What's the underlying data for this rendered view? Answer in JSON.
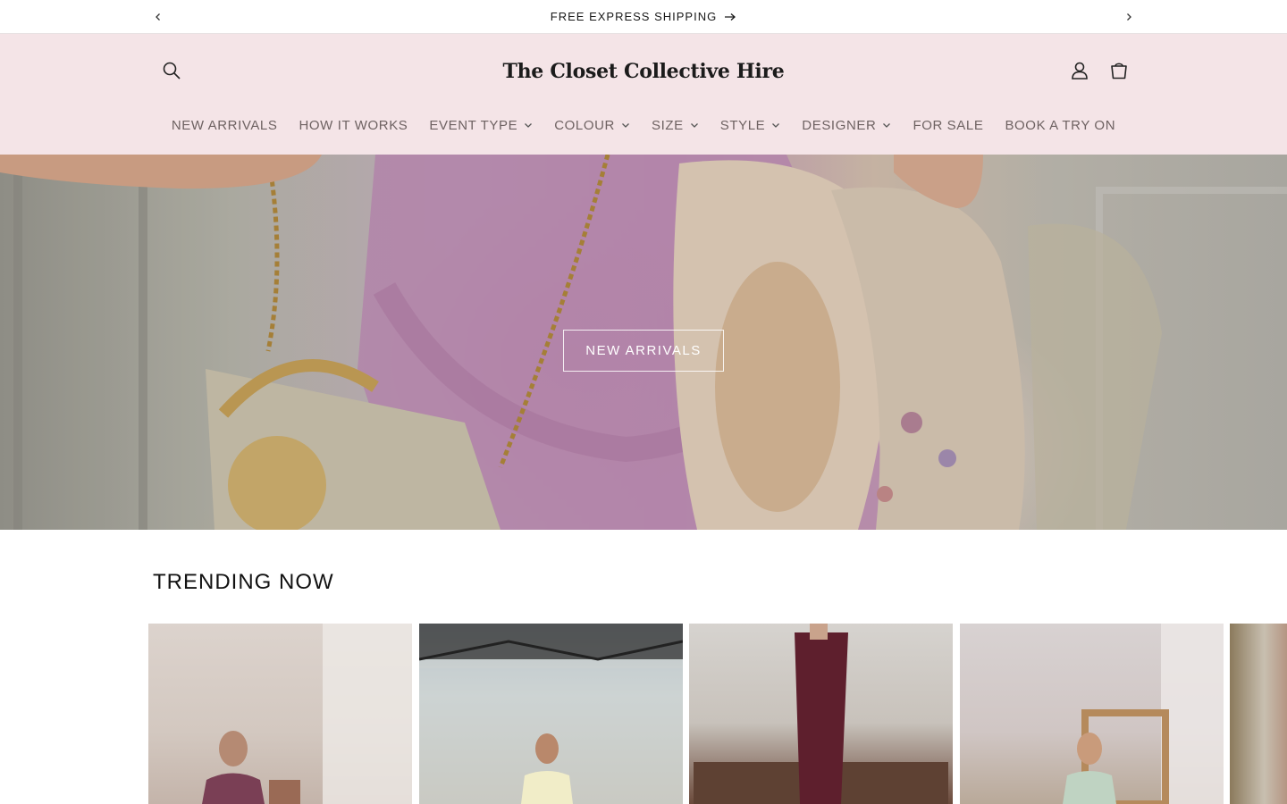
{
  "announcement": {
    "message": "FREE EXPRESS SHIPPING",
    "prev_icon": "chevron-left-icon",
    "next_icon": "chevron-right-icon",
    "arrow_icon": "arrow-right-icon"
  },
  "header": {
    "logo_text": "The Closet Collective Hire",
    "search_icon": "search-icon",
    "account_icon": "account-icon",
    "cart_icon": "cart-icon",
    "background": "#f4e4e7"
  },
  "nav": {
    "items": [
      {
        "label": "NEW ARRIVALS",
        "dropdown": false
      },
      {
        "label": "HOW IT WORKS",
        "dropdown": false
      },
      {
        "label": "EVENT TYPE",
        "dropdown": true
      },
      {
        "label": "COLOUR",
        "dropdown": true
      },
      {
        "label": "SIZE",
        "dropdown": true
      },
      {
        "label": "STYLE",
        "dropdown": true
      },
      {
        "label": "DESIGNER",
        "dropdown": true
      },
      {
        "label": "FOR SALE",
        "dropdown": false
      },
      {
        "label": "BOOK A TRY ON",
        "dropdown": false
      }
    ]
  },
  "hero": {
    "button_label": "NEW ARRIVALS"
  },
  "trending": {
    "title": "TRENDING NOW"
  }
}
